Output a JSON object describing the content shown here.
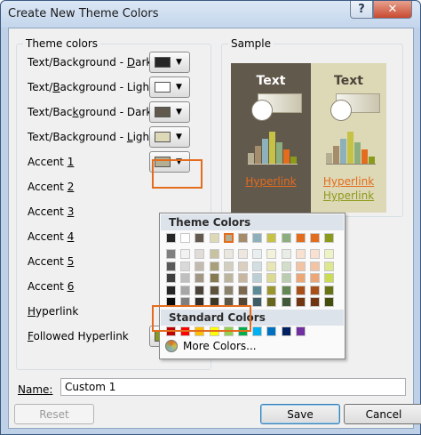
{
  "window": {
    "title": "Create New Theme Colors",
    "help": "?",
    "close": "✕"
  },
  "theme_colors": {
    "group_label": "Theme colors",
    "rows": [
      {
        "label": "Text/Background - Dark 1",
        "underline": "D",
        "swatch": "#262626"
      },
      {
        "label": "Text/Background - Light 1",
        "underline": "B",
        "swatch": "#ffffff"
      },
      {
        "label": "Text/Background - Dark 2",
        "underline": "k",
        "swatch": "#62594d"
      },
      {
        "label": "Text/Background - Light 2",
        "underline": "L",
        "swatch": "#ddd8b6"
      },
      {
        "label": "Accent 1",
        "underline": "1",
        "swatch": "#b5ae93"
      },
      {
        "label": "Accent 2",
        "underline": "2",
        "swatch": ""
      },
      {
        "label": "Accent 3",
        "underline": "3",
        "swatch": ""
      },
      {
        "label": "Accent 4",
        "underline": "4",
        "swatch": ""
      },
      {
        "label": "Accent 5",
        "underline": "5",
        "swatch": ""
      },
      {
        "label": "Accent 6",
        "underline": "6",
        "swatch": ""
      },
      {
        "label": "Hyperlink",
        "underline": "H",
        "swatch": ""
      },
      {
        "label": "Followed Hyperlink",
        "underline": "F",
        "swatch": "#8b9a1a"
      }
    ],
    "dropdown_arrow": "▼"
  },
  "sample": {
    "group_label": "Sample",
    "text": "Text",
    "hyperlink": "Hyperlink",
    "followed_hyperlink": "Hyperlink",
    "dark_bg": "#62594d",
    "light_bg": "#ddd8b6",
    "hyperlink_color": "#e36c1d",
    "followed_color": "#8b9a1a"
  },
  "dropdown": {
    "theme_colors_header": "Theme Colors",
    "standard_colors_header": "Standard Colors",
    "more_colors": "More Colors...",
    "theme_top": [
      "#262626",
      "#ffffff",
      "#62594d",
      "#ddd8b6",
      "#b5ae93",
      "#a58d6c",
      "#8db0ba",
      "#c5c245",
      "#8cae7f",
      "#e36c1d",
      "#e36c1d",
      "#8b9a1a"
    ],
    "theme_shades": [
      [
        "#7f7f7f",
        "#f2f2f2",
        "#e0dcd7",
        "#c7c2a0",
        "#e9e7df",
        "#ede7df",
        "#e8eff1",
        "#f3f2da",
        "#e8eee5",
        "#f9e1d1",
        "#f9e1d1",
        "#eef3c6"
      ],
      [
        "#595959",
        "#d9d9d9",
        "#c2baaf",
        "#a8a07a",
        "#d3cfbf",
        "#dbcfbf",
        "#d1dfe3",
        "#e8e6b5",
        "#d1deca",
        "#f3c4a4",
        "#f3c4a4",
        "#dde78d"
      ],
      [
        "#3f3f3f",
        "#bfbfbf",
        "#a29785",
        "#857a50",
        "#bdb69f",
        "#c8b7a0",
        "#bbcfd6",
        "#dcd991",
        "#bacdb0",
        "#eda776",
        "#eda776",
        "#cbdb54"
      ],
      [
        "#262626",
        "#a6a6a6",
        "#4a433a",
        "#5c533a",
        "#8a826a",
        "#7d694f",
        "#5d8a97",
        "#9a962c",
        "#628654",
        "#a9501a",
        "#a9501a",
        "#687314"
      ],
      [
        "#0c0c0c",
        "#7f7f7f",
        "#312c27",
        "#3d3726",
        "#5c5646",
        "#534634",
        "#3e5c65",
        "#66641d",
        "#415938",
        "#713511",
        "#713511",
        "#454d0d"
      ]
    ],
    "standard": [
      "#c00000",
      "#ff0000",
      "#ffc000",
      "#ffff00",
      "#92d050",
      "#00b050",
      "#00b0f0",
      "#0070c0",
      "#002060",
      "#7030a0"
    ]
  },
  "name_field": {
    "label": "Name:",
    "value": "Custom 1"
  },
  "buttons": {
    "reset": "Reset",
    "save": "Save",
    "cancel": "Cancel"
  }
}
